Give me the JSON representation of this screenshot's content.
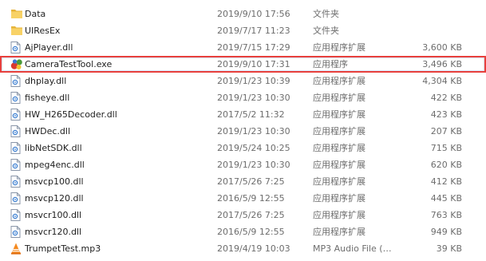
{
  "files": [
    {
      "name": "Data",
      "date": "2019/9/10 17:56",
      "type": "文件夹",
      "size": "",
      "icon": "folder-icon"
    },
    {
      "name": "UIResEx",
      "date": "2019/7/17 11:23",
      "type": "文件夹",
      "size": "",
      "icon": "folder-icon"
    },
    {
      "name": "AjPlayer.dll",
      "date": "2019/7/15 17:29",
      "type": "应用程序扩展",
      "size": "3,600 KB",
      "icon": "dll-file-icon"
    },
    {
      "name": "CameraTestTool.exe",
      "date": "2019/9/10 17:31",
      "type": "应用程序",
      "size": "3,496 KB",
      "icon": "exe-app-icon",
      "selected": true
    },
    {
      "name": "dhplay.dll",
      "date": "2019/1/23 10:39",
      "type": "应用程序扩展",
      "size": "4,304 KB",
      "icon": "dll-file-icon"
    },
    {
      "name": "fisheye.dll",
      "date": "2019/1/23 10:30",
      "type": "应用程序扩展",
      "size": "422 KB",
      "icon": "dll-file-icon"
    },
    {
      "name": "HW_H265Decoder.dll",
      "date": "2017/5/2 11:32",
      "type": "应用程序扩展",
      "size": "423 KB",
      "icon": "dll-file-icon"
    },
    {
      "name": "HWDec.dll",
      "date": "2019/1/23 10:30",
      "type": "应用程序扩展",
      "size": "207 KB",
      "icon": "dll-file-icon"
    },
    {
      "name": "libNetSDK.dll",
      "date": "2019/5/24 10:25",
      "type": "应用程序扩展",
      "size": "715 KB",
      "icon": "dll-file-icon"
    },
    {
      "name": "mpeg4enc.dll",
      "date": "2019/1/23 10:30",
      "type": "应用程序扩展",
      "size": "620 KB",
      "icon": "dll-file-icon"
    },
    {
      "name": "msvcp100.dll",
      "date": "2017/5/26 7:25",
      "type": "应用程序扩展",
      "size": "412 KB",
      "icon": "dll-file-icon"
    },
    {
      "name": "msvcp120.dll",
      "date": "2016/5/9 12:55",
      "type": "应用程序扩展",
      "size": "445 KB",
      "icon": "dll-file-icon"
    },
    {
      "name": "msvcr100.dll",
      "date": "2017/5/26 7:25",
      "type": "应用程序扩展",
      "size": "763 KB",
      "icon": "dll-file-icon"
    },
    {
      "name": "msvcr120.dll",
      "date": "2016/5/9 12:55",
      "type": "应用程序扩展",
      "size": "949 KB",
      "icon": "dll-file-icon"
    },
    {
      "name": "TrumpetTest.mp3",
      "date": "2019/4/19 10:03",
      "type": "MP3 Audio File (…",
      "size": "39 KB",
      "icon": "vlc-media-icon"
    }
  ],
  "colors": {
    "selection_outline": "#e8403c",
    "selection_fill": "#d9e8fb",
    "folder": "#f5c94a"
  }
}
